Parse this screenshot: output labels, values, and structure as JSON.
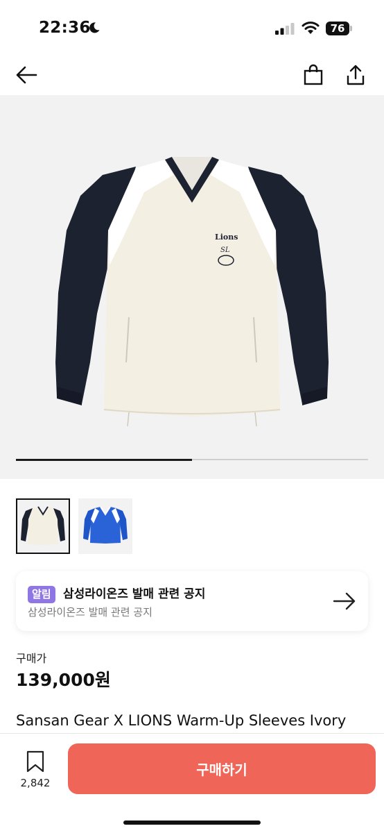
{
  "status_bar": {
    "time": "22:36",
    "battery": "76"
  },
  "nav": {
    "back_icon": "back-arrow-icon",
    "cart_icon": "shopping-bag-icon",
    "share_icon": "share-icon"
  },
  "gallery": {
    "progress": 0.5,
    "thumbnails": [
      "ivory-jacket",
      "blue-jacket"
    ],
    "selected_index": 0
  },
  "notice": {
    "badge": "알림",
    "title": "삼성라이온즈 발매 관련 공지",
    "subtitle": "삼성라이온즈 발매 관련 공지"
  },
  "price": {
    "label": "구매가",
    "value": "139,000원"
  },
  "product": {
    "title": "Sansan Gear X LIONS Warm-Up Sleeves Ivory"
  },
  "bottom_bar": {
    "wish_count": "2,842",
    "buy_label": "구매하기"
  },
  "colors": {
    "accent": "#ef6557",
    "badge": "#8e76e4",
    "navy": "#1c2230",
    "ivory": "#f4efe3",
    "blue": "#1f55c8"
  }
}
